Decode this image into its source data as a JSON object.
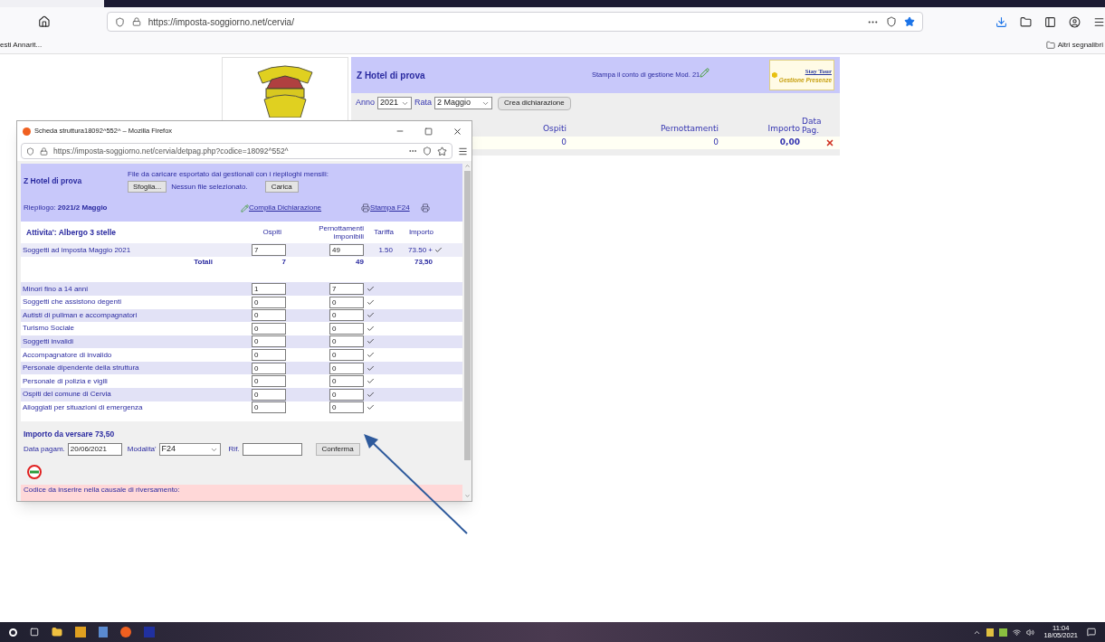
{
  "browser": {
    "url": "https://imposta-soggiorno.net/cervia/",
    "bookmark": "esti Annarit...",
    "other_bookmarks": "Altri segnalibri"
  },
  "page": {
    "hotel": "Z Hotel di prova",
    "print_link": "Stampa il conto di gestione Mod. 21",
    "staytour": {
      "title": "Stay Tour",
      "subtitle": "Gestione Presenze"
    },
    "anno_label": "Anno",
    "anno": "2021",
    "rata_label": "Rata",
    "rata": "2 Maggio",
    "create_button": "Crea dichiarazione",
    "table": {
      "columns": [
        "Ospiti",
        "Pernottamenti",
        "Importo",
        "Data Pag."
      ],
      "rows": [
        {
          "ospiti": "0",
          "pernottamenti": "0",
          "importo": "0,00"
        }
      ]
    }
  },
  "popup": {
    "title": "Scheda struttura18092^552^ – Mozilla Firefox",
    "url": "https://imposta-soggiorno.net/cervia/detpag.php?codice=18092^552^",
    "hotel": "Z Hotel di prova",
    "upload_label": "File da caricare esportato dai gestionali con i riepiloghi mensili:",
    "browse_button": "Sfoglia...",
    "no_file": "Nessun file selezionato.",
    "upload_button": "Carica",
    "summary": "Riepilogo: **2021/2 Maggio**",
    "compile_link": "Compila Dichiarazione",
    "f24_link": "Stampa F24",
    "table": {
      "activity": "Attivita': Albergo 3 stelle",
      "columns": [
        "Ospiti",
        "Pernottamenti imponibili",
        "Tariffa",
        "Importo"
      ],
      "main_row": {
        "label": "Soggetti ad imposta Maggio 2021",
        "ospiti": "7",
        "pernottamenti": "49",
        "tariffa": "1.50",
        "importo": "73.50 +"
      },
      "totals": {
        "label": "Totali",
        "ospiti": "7",
        "pernottamenti": "49",
        "importo": "73,50"
      },
      "exempt_rows": [
        {
          "label": "Minori fino a 14 anni",
          "ospiti": "1",
          "pernottamenti": "7"
        },
        {
          "label": "Soggetti che assistono degenti",
          "ospiti": "0",
          "pernottamenti": "0"
        },
        {
          "label": "Autisti di pullman e accompagnatori",
          "ospiti": "0",
          "pernottamenti": "0"
        },
        {
          "label": "Turismo Sociale",
          "ospiti": "0",
          "pernottamenti": "0"
        },
        {
          "label": "Soggetti invalidi",
          "ospiti": "0",
          "pernottamenti": "0"
        },
        {
          "label": "Accompagnatore di invalido",
          "ospiti": "0",
          "pernottamenti": "0"
        },
        {
          "label": "Personale dipendente della struttura",
          "ospiti": "0",
          "pernottamenti": "0"
        },
        {
          "label": "Personale di polizia e vigili",
          "ospiti": "0",
          "pernottamenti": "0"
        },
        {
          "label": "Ospiti del comune di Cervia",
          "ospiti": "0",
          "pernottamenti": "0"
        },
        {
          "label": "Alloggiati per situazioni di emergenza",
          "ospiti": "0",
          "pernottamenti": "0"
        }
      ]
    },
    "amount_due": "Importo da versare 73,50",
    "date_label": "Data pagam.",
    "date": "20/06/2021",
    "mode_label": "Modalita'",
    "mode": "F24",
    "ref_label": "Rif.",
    "confirm_button": "Conferma",
    "code_label": "Codice da inserire nella causale di riversamento:"
  },
  "taskbar": {
    "time": "11:04",
    "date": "18/05/2021"
  }
}
